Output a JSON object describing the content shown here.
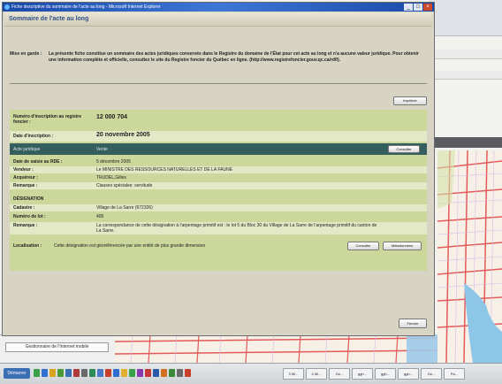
{
  "window": {
    "title": "Fiche descriptive du sommaire de l'acte au long - Microsoft Internet Explorer",
    "controls": [
      "_",
      "□",
      "×"
    ]
  },
  "page": {
    "title": "Sommaire de l'acte au long"
  },
  "warning": {
    "label": "Mise en garde :",
    "text": "La présente fiche constitue un sommaire des actes juridiques conservés dans le Registre du domaine de l'État pour cet acte au long et n'a aucune valeur juridique. Pour obtenir une information complète et officielle, consultez le site du Registre foncier du Québec en ligne. (http://www.registrefoncier.gouv.qc.ca/rdf/)."
  },
  "buttons": {
    "print": "Imprimer",
    "consult": "Consulter",
    "consult2": "Consulter",
    "metadata": "Métadonnées",
    "close": "Fermer"
  },
  "record": {
    "inscription_label": "Numéro d'inscription au registre foncier :",
    "inscription_value": "12 000 704",
    "date_inscription_label": "Date d'inscription :",
    "date_inscription_value": "20 novembre 2005",
    "acte_label": "Acte juridique",
    "acte_value": "Vente",
    "date_saisie_label": "Date de saisie au RDE :",
    "date_saisie_value": "5 décembre 2005",
    "vendeur_label": "Vendeur :",
    "vendeur_value": "Le MINISTRE DES RESSOURCES NATURELLES ET DE LA FAUNE",
    "acquereur_label": "Acquéreur :",
    "acquereur_value": "TRUDEL,Gilles",
    "remarque_label": "Remarque :",
    "remarque_value": "Clauses spéciales: servitude"
  },
  "designation": {
    "heading": "DÉSIGNATION",
    "cadastre_label": "Cadastre :",
    "cadastre_value": "Village de La Sarre (672326)",
    "lot_label": "Numéro de lot :",
    "lot_value": "405",
    "remarque_label": "Remarque :",
    "remarque_value": "La correspondance de cette désignation à l'arpentage primitif est : le lot 5 du Bloc 30 du Village de La Sarre de l'arpentage primitif du canton de La Sarre.",
    "localisation_label": "Localisation :",
    "localisation_value": "Cette désignation est géoréférencée par une entité de plus grande dimension"
  },
  "background": {
    "panel_tab": "Gestionnaire de l'Internet mobile"
  },
  "taskbar": {
    "start": "Démarrer",
    "tasks": [
      "3 Mi...",
      "4 Mi...",
      "Ge...",
      "ggh...",
      "ggh...",
      "ggh...",
      "Ge...",
      "Pa..."
    ]
  },
  "colors": {
    "accent": "#2f4f86",
    "card": "#cbd79b",
    "card_alt": "#e3e9c6",
    "dark_row": "#355e5e",
    "titlebar": "#1a49a8"
  }
}
